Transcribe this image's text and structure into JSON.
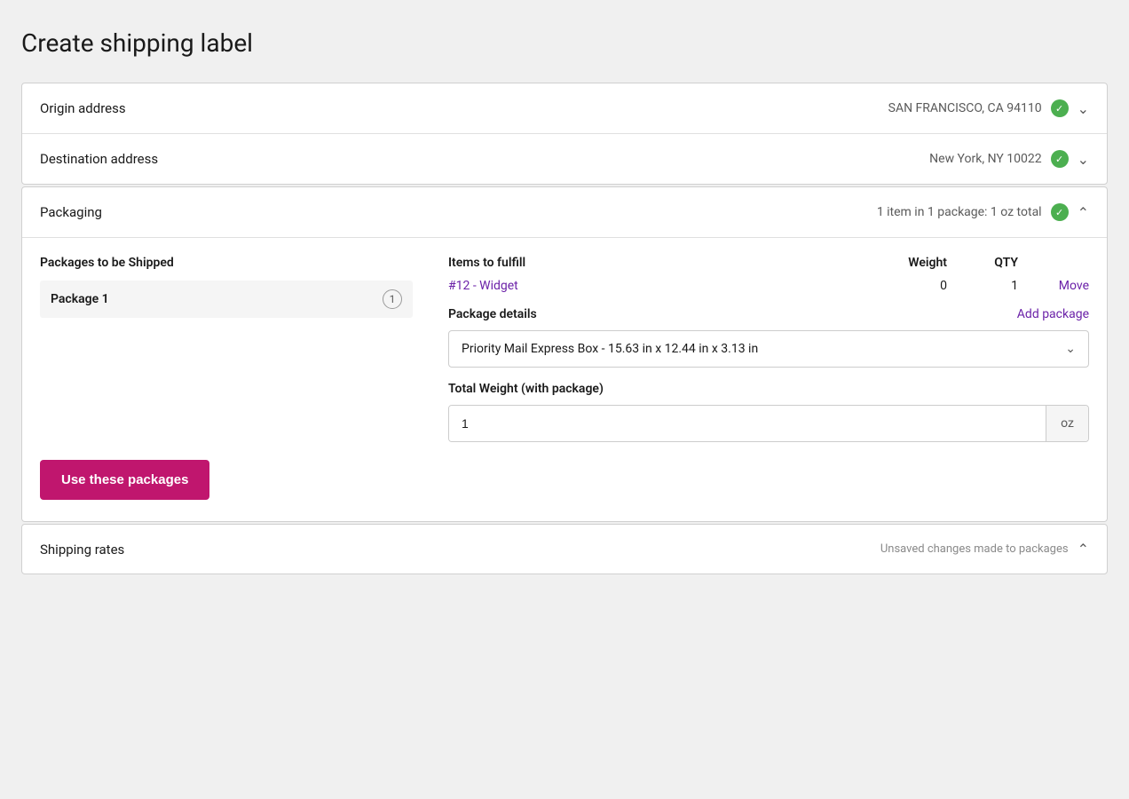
{
  "page": {
    "title": "Create shipping label"
  },
  "origin": {
    "label": "Origin address",
    "value": "SAN FRANCISCO, CA  94110",
    "verified": true
  },
  "destination": {
    "label": "Destination address",
    "value": "New York, NY  10022",
    "verified": true
  },
  "packaging": {
    "label": "Packaging",
    "summary": "1 item in 1 package: 1 oz total",
    "verified": true,
    "packages_header": "Packages to be Shipped",
    "items_header": "Items to fulfill",
    "weight_header": "Weight",
    "qty_header": "QTY",
    "package1": {
      "name": "Package 1",
      "badge": "1"
    },
    "item": {
      "link_text": "#12 - Widget",
      "weight": "0",
      "qty": "1",
      "move_label": "Move"
    },
    "package_details": {
      "label": "Package details",
      "add_package_label": "Add package",
      "selected_option": "Priority Mail Express Box - 15.63 in x 12.44 in x 3.13 in"
    },
    "total_weight": {
      "label": "Total Weight (with package)",
      "value": "1",
      "unit": "oz"
    },
    "use_packages_btn": "Use these packages"
  },
  "shipping_rates": {
    "label": "Shipping rates",
    "unsaved_text": "Unsaved changes made to packages",
    "chevron": "up"
  },
  "icons": {
    "check": "✓",
    "chevron_down": "∨",
    "chevron_up": "∧"
  }
}
